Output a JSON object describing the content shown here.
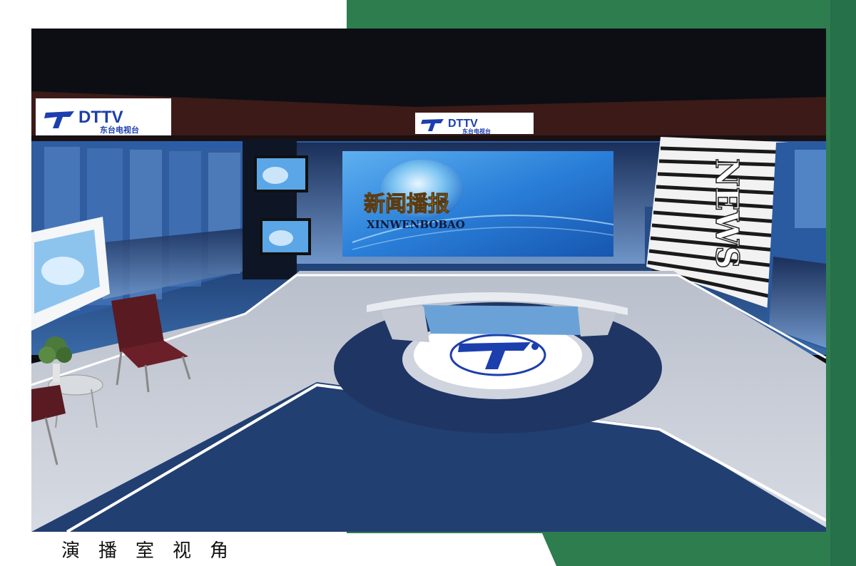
{
  "caption": "演播室视角",
  "logos": {
    "brand_en": "DTTV",
    "brand_cn": "东台电视台"
  },
  "main_screen": {
    "title_cn": "新闻播报",
    "title_en": "XINWENBOBAO"
  },
  "side_panel": {
    "word": "NEWS"
  },
  "colors": {
    "frame_green": "#2e7d4f",
    "stage_blue": "#1e3a6e",
    "logo_blue": "#1c3fae",
    "chair_red": "#5a1a22"
  }
}
